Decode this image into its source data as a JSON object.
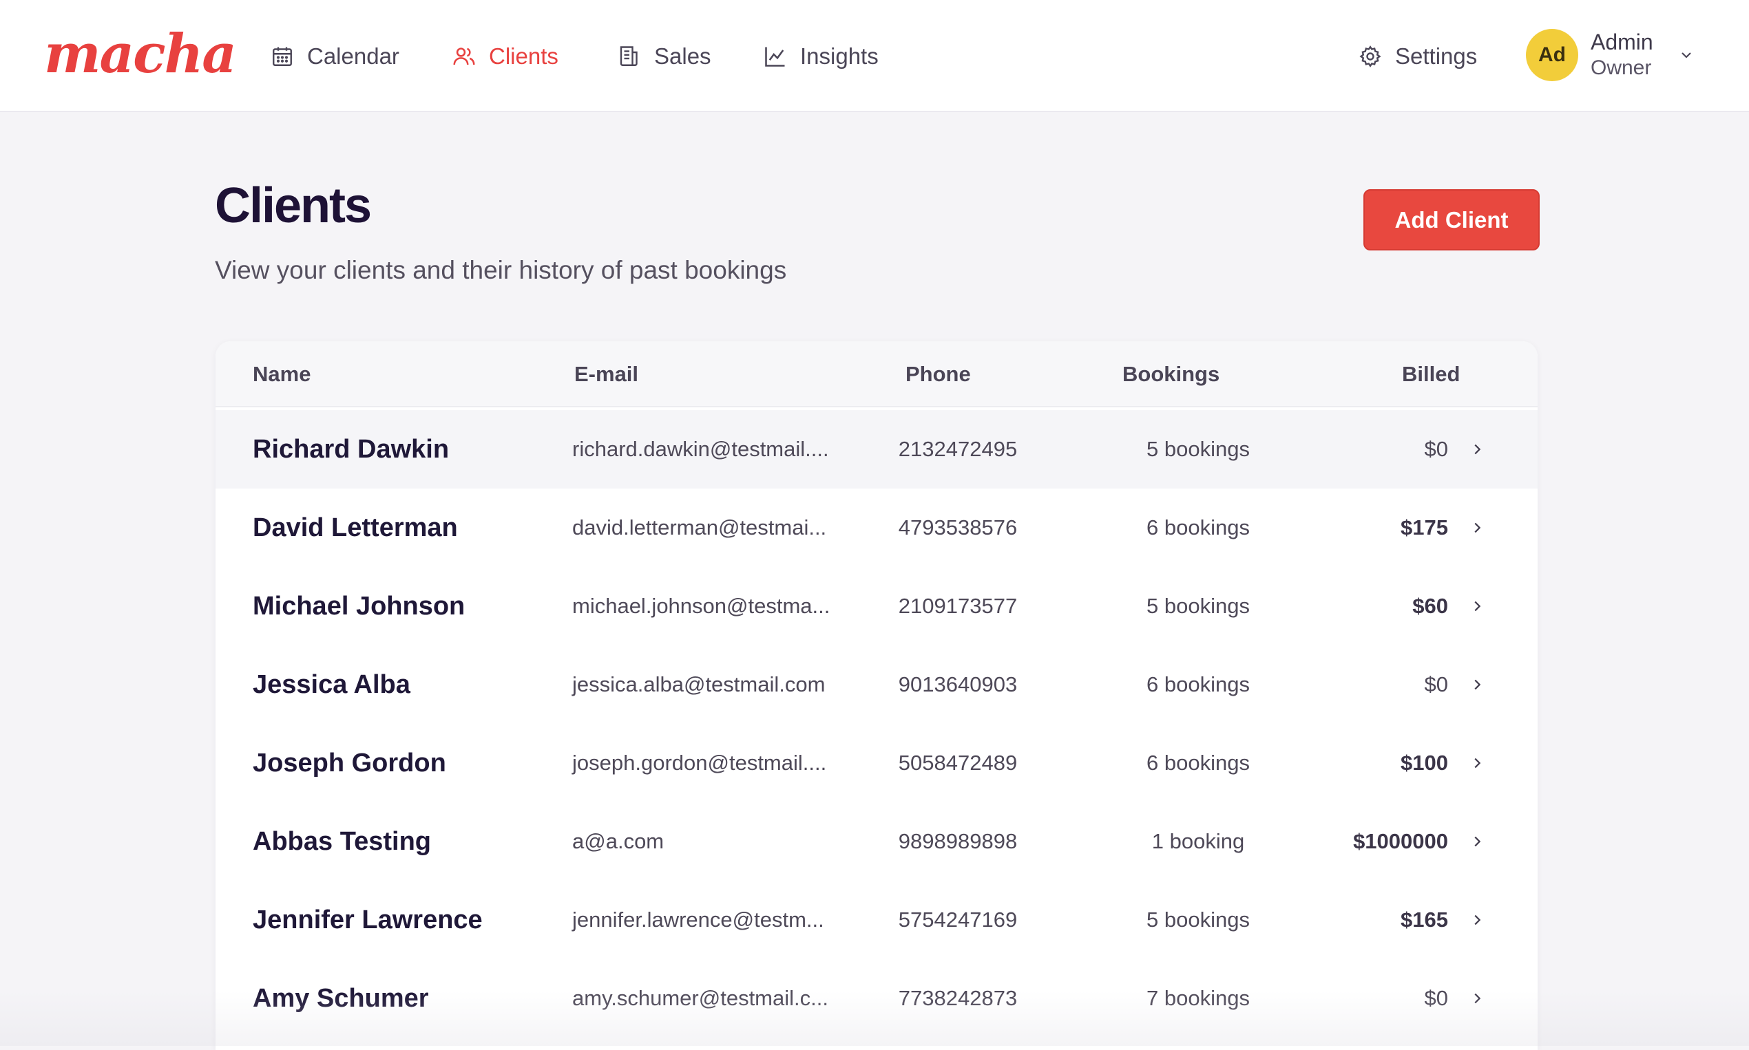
{
  "brand": {
    "logo_text": "macha",
    "accent_color": "#e8413f"
  },
  "nav": {
    "items": [
      {
        "label": "Calendar",
        "icon": "calendar-icon",
        "active": false
      },
      {
        "label": "Clients",
        "icon": "users-icon",
        "active": true
      },
      {
        "label": "Sales",
        "icon": "receipt-icon",
        "active": false
      },
      {
        "label": "Insights",
        "icon": "line-chart-icon",
        "active": false
      }
    ],
    "settings_label": "Settings"
  },
  "user": {
    "initials": "Ad",
    "name": "Admin",
    "role": "Owner",
    "avatar_color": "#f2cd3a"
  },
  "page": {
    "title": "Clients",
    "subtitle": "View your clients and their history of past bookings",
    "add_button_label": "Add Client"
  },
  "table": {
    "columns": [
      "Name",
      "E-mail",
      "Phone",
      "Bookings",
      "Billed"
    ],
    "rows": [
      {
        "name": "Richard Dawkin",
        "email": "richard.dawkin@testmail....",
        "phone": "2132472495",
        "bookings": "5 bookings",
        "billed": "$0",
        "billed_strong": false
      },
      {
        "name": "David Letterman",
        "email": "david.letterman@testmai...",
        "phone": "4793538576",
        "bookings": "6 bookings",
        "billed": "$175",
        "billed_strong": true
      },
      {
        "name": "Michael Johnson",
        "email": "michael.johnson@testma...",
        "phone": "2109173577",
        "bookings": "5 bookings",
        "billed": "$60",
        "billed_strong": true
      },
      {
        "name": "Jessica Alba",
        "email": "jessica.alba@testmail.com",
        "phone": "9013640903",
        "bookings": "6 bookings",
        "billed": "$0",
        "billed_strong": false
      },
      {
        "name": "Joseph Gordon",
        "email": "joseph.gordon@testmail....",
        "phone": "5058472489",
        "bookings": "6 bookings",
        "billed": "$100",
        "billed_strong": true
      },
      {
        "name": "Abbas Testing",
        "email": "a@a.com",
        "phone": "9898989898",
        "bookings": "1 booking",
        "billed": "$1000000",
        "billed_strong": true
      },
      {
        "name": "Jennifer Lawrence",
        "email": "jennifer.lawrence@testm...",
        "phone": "5754247169",
        "bookings": "5 bookings",
        "billed": "$165",
        "billed_strong": true
      },
      {
        "name": "Amy Schumer",
        "email": "amy.schumer@testmail.c...",
        "phone": "7738242873",
        "bookings": "7 bookings",
        "billed": "$0",
        "billed_strong": false
      }
    ]
  }
}
